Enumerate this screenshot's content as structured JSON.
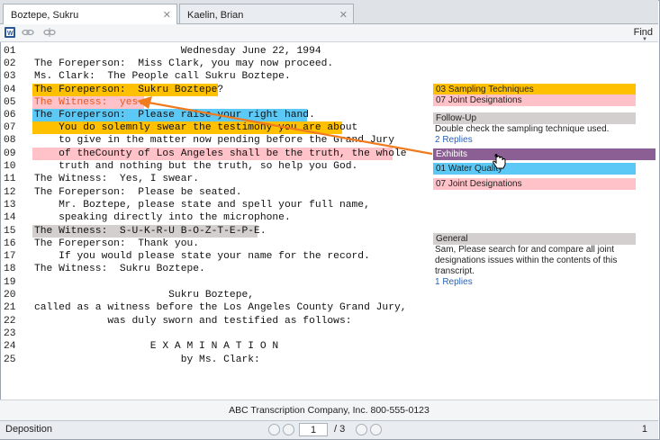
{
  "tabs": [
    {
      "label": "Boztepe, Sukru"
    },
    {
      "label": "Kaelin, Brian"
    }
  ],
  "toolbar": {
    "find_label": "Find"
  },
  "transcript": {
    "lines": [
      {
        "num": "01",
        "text": "                        Wednesday June 22, 1994"
      },
      {
        "num": "02",
        "text": "The Foreperson:  Miss Clark, you may now proceed."
      },
      {
        "num": "03",
        "text": "Ms. Clark:  The People call Sukru Boztepe."
      },
      {
        "num": "04",
        "text": "The Foreperson:  Sukru Boztepe?"
      },
      {
        "num": "05",
        "text": "The Witness:  yes."
      },
      {
        "num": "06",
        "text": "The Foreperson:  Please raise your right hand."
      },
      {
        "num": "07",
        "text": "    You do solemnly swear the testimony you are about"
      },
      {
        "num": "08",
        "text": "    to give in the matter now pending before the Grand Jury"
      },
      {
        "num": "09",
        "text": "    of theCounty of Los Angeles shall be the truth, the whole"
      },
      {
        "num": "10",
        "text": "    truth and nothing but the truth, so help you God."
      },
      {
        "num": "11",
        "text": "The Witness:  Yes, I swear."
      },
      {
        "num": "12",
        "text": "The Foreperson:  Please be seated."
      },
      {
        "num": "13",
        "text": "    Mr. Boztepe, please state and spell your full name,"
      },
      {
        "num": "14",
        "text": "    speaking directly into the microphone."
      },
      {
        "num": "15",
        "text": "The Witness:  S-U-K-R-U B-O-Z-T-E-P-E."
      },
      {
        "num": "16",
        "text": "The Foreperson:  Thank you."
      },
      {
        "num": "17",
        "text": "    If you would please state your name for the record."
      },
      {
        "num": "18",
        "text": "The Witness:  Sukru Boztepe."
      },
      {
        "num": "19",
        "text": ""
      },
      {
        "num": "20",
        "text": "                      Sukru Boztepe,"
      },
      {
        "num": "21",
        "text": "called as a witness before the Los Angeles County Grand Jury,"
      },
      {
        "num": "22",
        "text": "            was duly sworn and testified as follows:"
      },
      {
        "num": "23",
        "text": ""
      },
      {
        "num": "24",
        "text": "                   E X A M I N A T I O N"
      },
      {
        "num": "25",
        "text": "                        by Ms. Clark:"
      }
    ]
  },
  "annotations": {
    "sampling": "03 Sampling Techniques",
    "joint1": "07 Joint Designations",
    "followup_title": "Follow-Up",
    "followup_text": "Double check the sampling technique used.",
    "followup_replies": "2 Replies",
    "exhibits": "Exhibits",
    "water": "01 Water Quality",
    "joint2": "07 Joint Designations",
    "general_title": "General",
    "general_text": "Sam, Please search for and compare all joint designations issues within the contents of this transcript.",
    "general_replies": "1 Replies"
  },
  "colors": {
    "orange": "#ffc000",
    "blue": "#5bc8f5",
    "pink": "#ffc2c8",
    "gray": "#d3cfcf",
    "purple": "#8b5e94",
    "arrow": "#f07b1e",
    "witness_text": "#e8561a"
  },
  "footer": {
    "company": "ABC Transcription Company, Inc. 800-555-0123"
  },
  "status": {
    "left": "Deposition",
    "page_value": "1",
    "page_total": "/ 3",
    "right": "1"
  }
}
